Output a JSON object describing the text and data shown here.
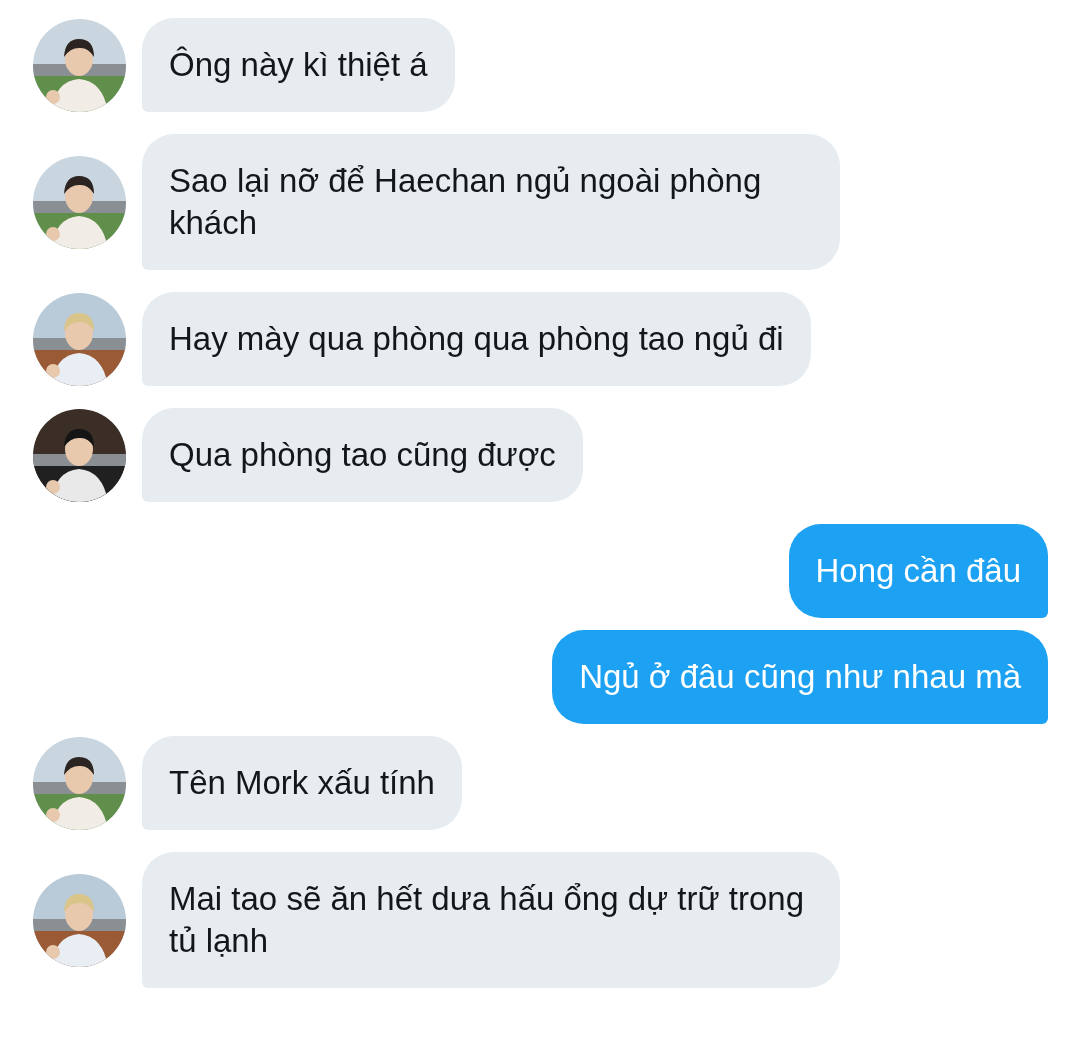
{
  "messages": [
    {
      "kind": "received",
      "text": "Ông này kì thiệt á"
    },
    {
      "kind": "received",
      "text": "Sao lại nỡ để Haechan ngủ ngoài phòng khách"
    },
    {
      "kind": "received",
      "text": "Hay mày qua phòng qua phòng tao ngủ đi"
    },
    {
      "kind": "received",
      "text": "Qua phòng tao cũng được"
    },
    {
      "kind": "sent",
      "text": "Hong cần đâu"
    },
    {
      "kind": "sent",
      "text": "Ngủ ở đâu cũng như nhau mà"
    },
    {
      "kind": "received",
      "text": "Tên Mork xấu tính"
    },
    {
      "kind": "received",
      "text": "Mai tao sẽ ăn hết dưa hấu ổng dự trữ trong tủ lạnh"
    }
  ]
}
